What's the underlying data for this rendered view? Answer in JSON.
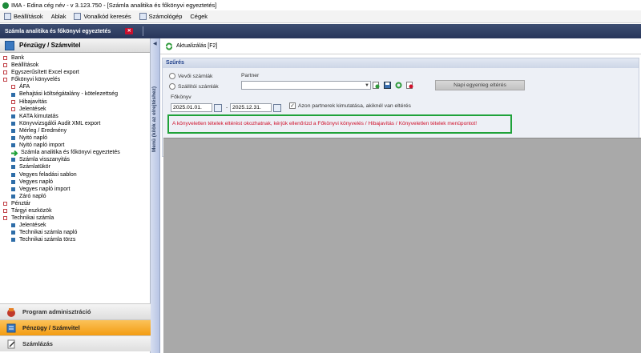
{
  "window": {
    "title": "IMA - Edina cég név - v 3.123.750 - [Számla analitika és főkönyvi egyeztetés]"
  },
  "menubar": {
    "items": [
      {
        "label": "Beállítások",
        "icon": "settings-icon"
      },
      {
        "label": "Ablak",
        "icon": ""
      },
      {
        "label": "Vonalkód keresés",
        "icon": "barcode-icon"
      },
      {
        "label": "Számológép",
        "icon": "calculator-icon"
      },
      {
        "label": "Cégek",
        "icon": ""
      }
    ]
  },
  "tabs": [
    {
      "label": "Számla analitika és főkönyvi egyeztetés",
      "close": "✕"
    }
  ],
  "sidebar": {
    "header": "Pénzügy / Számvitel",
    "items": [
      {
        "label": "Bank",
        "level": 0,
        "bullet": "red"
      },
      {
        "label": "Beállítások",
        "level": 0,
        "bullet": "red"
      },
      {
        "label": "Egyszerűsített Excel export",
        "level": 0,
        "bullet": "red"
      },
      {
        "label": "Főkönyvi könyvelés",
        "level": 0,
        "bullet": "red"
      },
      {
        "label": "ÁFA",
        "level": 1,
        "bullet": "red"
      },
      {
        "label": "Behajtási költségátalány - kötelezettség",
        "level": 1,
        "bullet": "blue"
      },
      {
        "label": "Hibajavítás",
        "level": 1,
        "bullet": "red"
      },
      {
        "label": "Jelentések",
        "level": 1,
        "bullet": "red"
      },
      {
        "label": "KATA kimutatás",
        "level": 1,
        "bullet": "blue"
      },
      {
        "label": "Könyvvizsgálói Audit XML export",
        "level": 1,
        "bullet": "blue"
      },
      {
        "label": "Mérleg / Eredmény",
        "level": 1,
        "bullet": "blue"
      },
      {
        "label": "Nyitó napló",
        "level": 1,
        "bullet": "blue"
      },
      {
        "label": "Nyitó napló import",
        "level": 1,
        "bullet": "blue"
      },
      {
        "label": "Számla analitika és főkönyvi egyeztetés",
        "level": 1,
        "bullet": "arrow"
      },
      {
        "label": "Számla visszanyitás",
        "level": 1,
        "bullet": "blue"
      },
      {
        "label": "Számlatükör",
        "level": 1,
        "bullet": "blue"
      },
      {
        "label": "Vegyes feladási sablon",
        "level": 1,
        "bullet": "blue"
      },
      {
        "label": "Vegyes napló",
        "level": 1,
        "bullet": "blue"
      },
      {
        "label": "Vegyes napló import",
        "level": 1,
        "bullet": "blue"
      },
      {
        "label": "Záró napló",
        "level": 1,
        "bullet": "blue"
      },
      {
        "label": "Pénztár",
        "level": 0,
        "bullet": "red"
      },
      {
        "label": "Tárgyi eszközök",
        "level": 0,
        "bullet": "red"
      },
      {
        "label": "Technikai számla",
        "level": 0,
        "bullet": "red"
      },
      {
        "label": "Jelentések",
        "level": 1,
        "bullet": "blue"
      },
      {
        "label": "Technikai számla napló",
        "level": 1,
        "bullet": "blue"
      },
      {
        "label": "Technikai számla törzs",
        "level": 1,
        "bullet": "blue"
      }
    ],
    "collapse_label": "Menü (kilök az elrejtéshez)",
    "nav": [
      {
        "label": "Program adminisztráció",
        "active": false
      },
      {
        "label": "Pénzügy / Számvitel",
        "active": true
      },
      {
        "label": "Számlázás",
        "active": false
      }
    ]
  },
  "toolbar": {
    "refresh_label": "Aktualizálás [F2]"
  },
  "filter": {
    "title": "Szűrés",
    "radio_vevoi": "Vevői számlák",
    "radio_szallitoi": "Szállítói számlák",
    "partner_label": "Partner",
    "partner_value": "",
    "napi_button": "Napi egyenleg eltérés",
    "fokonyv_label": "Főkönyv",
    "date_from": "2025.01.01.",
    "date_sep": "-",
    "date_to": "2025.12.31.",
    "checkbox_label": "Azon partnerek kimutatása, akiknél van eltérés",
    "checkbox_checked": "✓",
    "warning": "A könyveletlen tételek eltérést okozhatnak, kérjük ellenőrizd a Főkönyvi könyvelés / Hibajavítás / Könyveletlen tételek menüpontot!"
  },
  "colors": {
    "accent": "#1fa23a",
    "warning_text": "#d0112b",
    "tabbar": "#2f3d60",
    "nav_active": "#f5a623"
  }
}
